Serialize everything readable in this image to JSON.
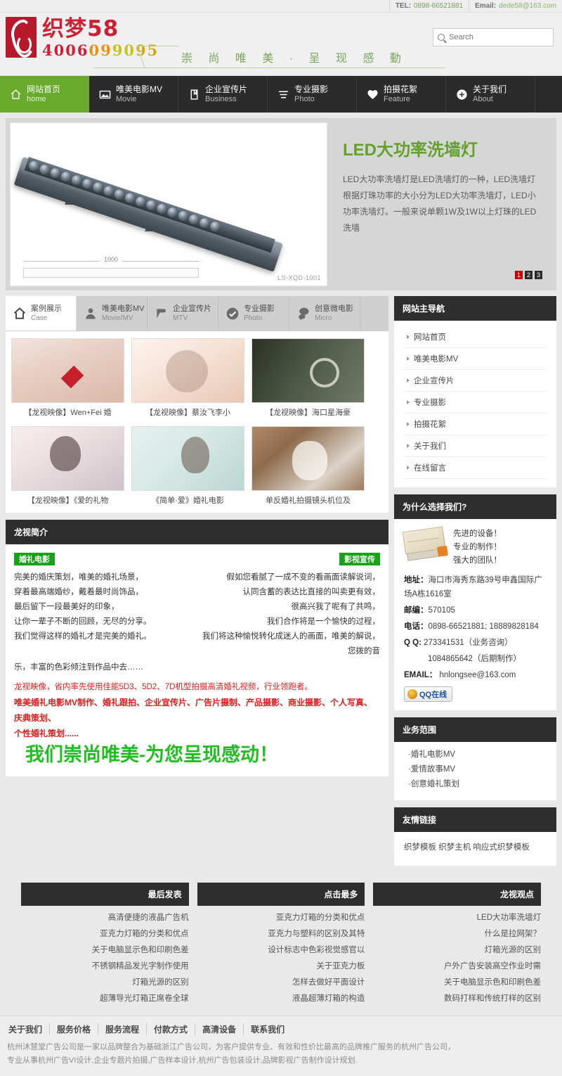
{
  "topbar": {
    "tel_label": "TEL:",
    "tel_value": "0898-66521881",
    "email_label": "Email:",
    "email_value": "dede58@163.com"
  },
  "header": {
    "logo_name": "织梦58",
    "logo_phone": "4006099095",
    "slogan": "崇 尚 唯 美 · 呈 现 感 動",
    "search_placeholder": "Search",
    "search_value": ""
  },
  "mainnav": [
    {
      "cn": "网站首页",
      "en": "home",
      "icon": "home-icon",
      "active": true
    },
    {
      "cn": "唯美电影MV",
      "en": "Movie",
      "icon": "image-icon",
      "active": false
    },
    {
      "cn": "企业宣传片",
      "en": "Business",
      "icon": "book-icon",
      "active": false
    },
    {
      "cn": "专业摄影",
      "en": "Photo",
      "icon": "list-icon",
      "active": false
    },
    {
      "cn": "拍摄花絮",
      "en": "Feature",
      "icon": "heart-icon",
      "active": false
    },
    {
      "cn": "关于我们",
      "en": "About",
      "icon": "plus-circle-icon",
      "active": false
    }
  ],
  "banner": {
    "title": "LED大功率洗墙灯",
    "desc": "LED大功率洗墙灯是LED洗墙灯的一种，LED洗墙灯根据灯珠功率的大小分为LED大功率洗墙灯，LED小功率洗墙灯。一般来说单颗1W及1W以上灯珠的LED洗墙",
    "image_dimension": "1000",
    "image_code": "LS-XQD-1001",
    "dots": [
      "1",
      "2",
      "3"
    ],
    "active_dot": 0
  },
  "tabs": [
    {
      "cn": "案例展示",
      "en": "Case",
      "icon": "home-icon",
      "active": true
    },
    {
      "cn": "唯美电影MV",
      "en": "Movie/MV",
      "icon": "user-icon",
      "active": false
    },
    {
      "cn": "企业宣传片",
      "en": "MTV",
      "icon": "pin-icon",
      "active": false
    },
    {
      "cn": "专业摄影",
      "en": "Photo",
      "icon": "check-circle-icon",
      "active": false
    },
    {
      "cn": "创意微电影",
      "en": "Micro",
      "icon": "chat-icon",
      "active": false
    }
  ],
  "gallery": [
    {
      "caption": "【龙视映像】Wen+Fei 婚",
      "style": "ph1"
    },
    {
      "caption": "【龙视映像】蔡汝飞李小",
      "style": "ph2"
    },
    {
      "caption": "【龙视映像】海口星海豪",
      "style": "ph3"
    },
    {
      "caption": "【龙视映像】《爱的礼物",
      "style": "ph4"
    },
    {
      "caption": "《简单·爱》婚礼电影",
      "style": "ph5"
    },
    {
      "caption": "单反婚礼拍摄镜头机位及",
      "style": "ph6"
    }
  ],
  "intro": {
    "head": "龙视简介",
    "left_tag": "婚礼电影",
    "right_tag": "影视宣传",
    "left_lines": [
      "完美的婚庆策划，唯美的婚礼场景，",
      "穿着最高端婚纱，戴着最时尚饰品，",
      "最后留下一段最美好的印象，",
      "让你一辈子不断的回顾，无尽的分享。",
      "我们觉得这样的婚礼才是完美的婚礼。"
    ],
    "right_lines": [
      "假如您看腻了一成不变的看画面读解说词，",
      "认同含蓄的表达比直接的叫卖更有效，",
      "很高兴我了呢有了共鸣，",
      "我们合作将是一个愉快的过程，",
      "我们将这种愉悦转化成迷人的画面，唯美的解说，"
    ],
    "tail_right": "您拨的音",
    "tail_line": "乐，丰富的色彩倾注到作品中去……",
    "red_line": "龙视映像，省内率先使用佳能5D3、5D2、7D机型拍摄高清婚礼视频，行业领跑者。",
    "red_bold_1": "唯美婚礼电影MV制作、婚礼跟拍、企业宣传片、广告片摄制、产品摄影、商业摄影、个人写真、庆典策划、",
    "red_bold_2": "个性婚礼策划......",
    "big_green": "我们崇尚唯美-为您呈现感动！"
  },
  "sidebar": {
    "nav": {
      "head": "网站主导航",
      "items": [
        "网站首页",
        "唯美电影MV",
        "企业宣传片",
        "专业摄影",
        "拍摄花絮",
        "关于我们",
        "在线留言"
      ]
    },
    "why": {
      "head": "为什么选择我们?",
      "lines": [
        "先进的设备！",
        "专业的制作！",
        "强大的团队！"
      ],
      "address_label": "地址：",
      "address_value": "海口市海秀东路39号申鑫国际广场A栋1616室",
      "zip_label": "邮编：",
      "zip_value": "570105",
      "phone_label": "电话：",
      "phone_value": "0898-66521881; 18889828184",
      "qq_label": "Q Q:",
      "qq_value": "273341531（业务咨询）",
      "qq_value2": "1084865642（后期制作）",
      "email_label": "EMAIL：",
      "email_value": "hnlongsee@163.com",
      "qq_button": "QQ在线"
    },
    "business": {
      "head": "业务范围",
      "items": [
        "·婚礼电影MV",
        "·爱情故事MV",
        "·创意婚礼策划"
      ]
    },
    "links": {
      "head": "友情链接",
      "text": "织梦模板 织梦主机 响应式织梦模板"
    }
  },
  "bottom_columns": [
    {
      "head": "最后发表",
      "items": [
        "高清便捷的液晶广告机",
        "亚克力灯箱的分类和优点",
        "关于电脑显示色和印刷色差",
        "不锈钢精品发光字制作使用",
        "灯箱光源的区别",
        "超薄导光灯箱正席卷全球"
      ]
    },
    {
      "head": "点击最多",
      "items": [
        "亚克力灯箱的分类和优点",
        "亚克力与塑料的区别及其特",
        "设计标志中色彩视觉感官以",
        "关于亚克力板",
        "怎样去做好平面设计",
        "液晶超薄灯箱的构造"
      ]
    },
    {
      "head": "龙视观点",
      "items": [
        "LED大功率洗墙灯",
        "什么是拉网架？",
        "灯箱光源的区别",
        "户外广告安装高空作业时需",
        "关于电脑显示色和印刷色差",
        "数码打样和传统打样的区别"
      ]
    }
  ],
  "footer": {
    "links": [
      "关于我们",
      "服务价格",
      "服务流程",
      "付款方式",
      "高清设备",
      "联系我们"
    ],
    "desc_line1": "杭州沐慧堂广告公司是一家以品牌整合为基础浙江广告公司，为客户提供专业、有效和性价比最高的品牌推广服务的杭州广告公司，",
    "desc_line2": "专业从事杭州广告VI设计,企业专题片拍摄,广告样本设计,杭州广告包装设计,品牌影视广告制作设计规划."
  },
  "colors": {
    "accent_green": "#68aa2c",
    "logo_red": "#cf1f33",
    "dark_header": "#2e2e2e",
    "tag_green": "#17a217",
    "red_text": "#e21b1b",
    "big_green": "#1fbf1f"
  }
}
